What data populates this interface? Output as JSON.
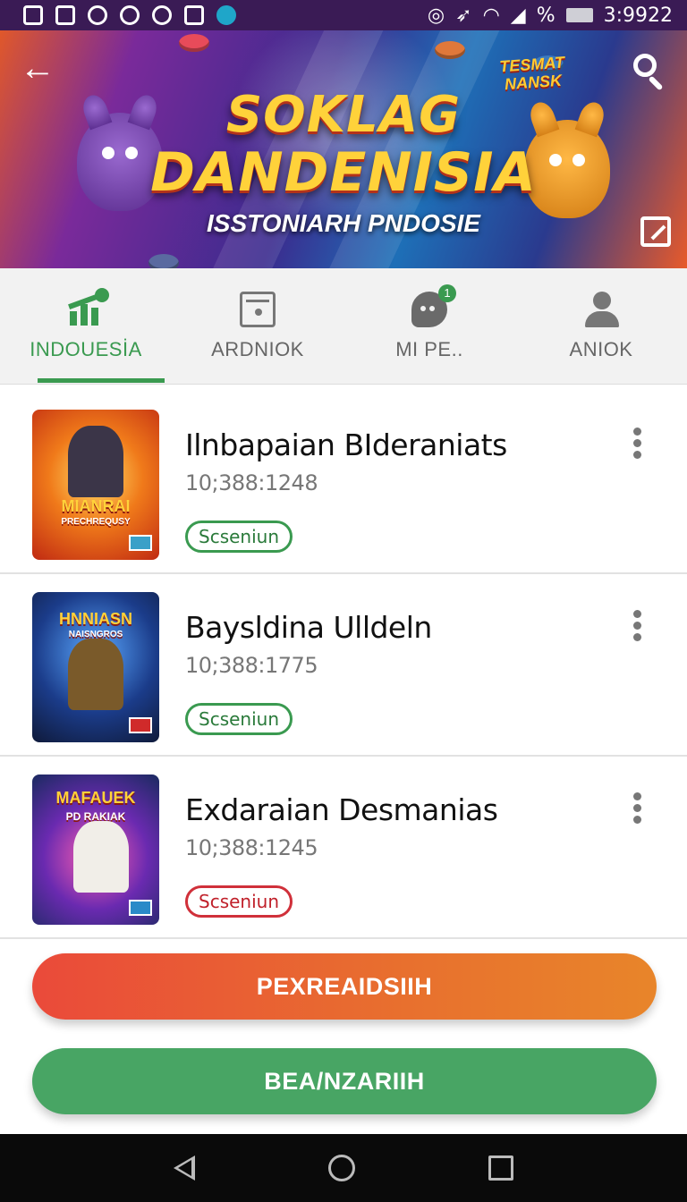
{
  "status_bar": {
    "battery_text": "%",
    "time": "3:9922"
  },
  "banner": {
    "title_line1": "SOKLAG",
    "title_line2": "DANDENISIA",
    "subtitle": "ISSTONIARH PNDOSIE",
    "badge_line1": "TESMAT",
    "badge_line2": "NANSK"
  },
  "tabs": [
    {
      "label": "INDOUESİA",
      "icon": "home-chart-icon",
      "active": true
    },
    {
      "label": "ARDNIOK",
      "icon": "game-card-icon",
      "active": false
    },
    {
      "label": "MI PE..",
      "icon": "chat-bubble-icon",
      "badge": "1",
      "active": false
    },
    {
      "label": "ANIOK",
      "icon": "person-icon",
      "active": false
    }
  ],
  "items": [
    {
      "title": "Ilnbapaian BIderaniats",
      "meta": "10;388:1248",
      "status": "Scseniun",
      "status_color": "#3a9a50",
      "thumb_text": "MIANRAI",
      "thumb_sub": "PRECHREQUSY"
    },
    {
      "title": "Baysldina Ulldeln",
      "meta": "10;388:1775",
      "status": "Scseniun",
      "status_color": "#3a9a50",
      "thumb_text": "HNNIASN",
      "thumb_sub": "NAISNGROS"
    },
    {
      "title": "Exdaraian Desmanias",
      "meta": "10;388:1245",
      "status": "Scseniun",
      "status_color": "#d0303a",
      "thumb_text": "MAFAUEK",
      "thumb_sub": "PD RAKIAK"
    }
  ],
  "buttons": {
    "primary": "PEXREAIDSIIH",
    "secondary": "BEA/NZARIIH"
  },
  "colors": {
    "accent_green": "#3a9a50",
    "accent_orange": "#e8702e",
    "status_bar": "#3a1b55"
  }
}
